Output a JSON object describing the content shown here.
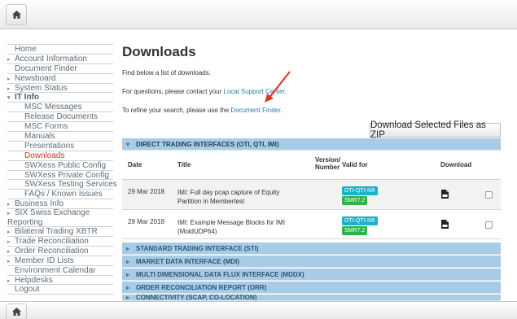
{
  "page": {
    "title": "Downloads"
  },
  "intro": {
    "line1": "Find below a list of downloads.",
    "line2_prefix": "For questions, please contact your ",
    "line2_link": "Local Support Center",
    "line2_suffix": ".",
    "line3_prefix": "To refine your search, please use the ",
    "line3_link": "Document Finder",
    "line3_suffix": "."
  },
  "zip_button": "Download Selected Files as ZIP",
  "sidebar": {
    "items": [
      {
        "label": "Home",
        "arrow": "",
        "sub": false
      },
      {
        "label": "Account Information",
        "arrow": "▸",
        "sub": false
      },
      {
        "label": "Document Finder",
        "arrow": "",
        "sub": false
      },
      {
        "label": "Newsboard",
        "arrow": "▸",
        "sub": false
      },
      {
        "label": "System Status",
        "arrow": "▸",
        "sub": false
      },
      {
        "label": "IT Info",
        "arrow": "▾",
        "sub": false,
        "open": true
      },
      {
        "label": "MSC Messages",
        "arrow": "",
        "sub": true
      },
      {
        "label": "Release Documents",
        "arrow": "",
        "sub": true
      },
      {
        "label": "MSC Forms",
        "arrow": "",
        "sub": true
      },
      {
        "label": "Manuals",
        "arrow": "",
        "sub": true
      },
      {
        "label": "Presentations",
        "arrow": "",
        "sub": true
      },
      {
        "label": "Downloads",
        "arrow": "",
        "sub": true,
        "active": true
      },
      {
        "label": "SWXess Public Config",
        "arrow": "",
        "sub": true
      },
      {
        "label": "SWXess Private Config",
        "arrow": "",
        "sub": true
      },
      {
        "label": "SWXess Testing Services",
        "arrow": "",
        "sub": true
      },
      {
        "label": "FAQs / Known Issues",
        "arrow": "",
        "sub": true
      },
      {
        "label": "Business Info",
        "arrow": "▸",
        "sub": false
      },
      {
        "label": "SIX Swiss Exchange Reporting",
        "arrow": "▸",
        "sub": false,
        "tall": true
      },
      {
        "label": "Bilateral Trading XBTR",
        "arrow": "▸",
        "sub": false
      },
      {
        "label": "Trade Reconciliation",
        "arrow": "▸",
        "sub": false
      },
      {
        "label": "Order Reconciliation",
        "arrow": "▸",
        "sub": false
      },
      {
        "label": "Member ID Lists",
        "arrow": "▸",
        "sub": false
      },
      {
        "label": "Environment Calendar",
        "arrow": "",
        "sub": false
      },
      {
        "label": "Helpdesks",
        "arrow": "▸",
        "sub": false
      },
      {
        "label": "Logout",
        "arrow": "",
        "sub": false
      }
    ]
  },
  "table": {
    "section_open": "DIRECT TRADING INTERFACES (OTI, QTI, IMI)",
    "headers": {
      "date": "Date",
      "title": "Title",
      "version_line1": "Version/",
      "version_line2": "Number",
      "valid_for": "Valid for",
      "download": "Download"
    },
    "rows": [
      {
        "date": "29 Mar 2018",
        "title_line1": "IMI: Full day pcap capture of Equity",
        "title_line2": "Partition in Membertest",
        "badge1": "OTI-QTI-IMI",
        "badge2": "SMR7.2"
      },
      {
        "date": "29 Mar 2018",
        "title_line1": "IMI: Example Message Blocks for IMI",
        "title_line2": "(MoldUDP64)",
        "badge1": "OTI-QTI-IMI",
        "badge2": "SMR7.2"
      }
    ],
    "collapsed_sections": [
      "STANDARD TRADING INTERFACE (STI)",
      "MARKET DATA INTERFACE (MDI)",
      "MULTI DIMENSIONAL DATA FLUX INTERFACE (MDDX)",
      "ORDER RECONCILIATION REPORT (ORR)",
      "CONNECTIVITY (SCAP, CO-LOCATION)"
    ]
  },
  "colors": {
    "accent_link": "#2a7ab0",
    "section_bar": "#a8cbe6",
    "active_nav": "#cc3322",
    "badge_cyan": "#19b3c8",
    "badge_green": "#2db34a"
  },
  "icons": {
    "home": "home-icon",
    "download": "file-download-icon",
    "annotation": "red-arrow-icon"
  }
}
